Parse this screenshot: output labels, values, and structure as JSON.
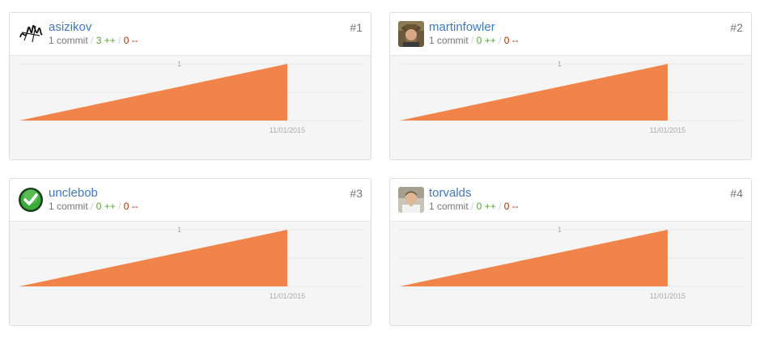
{
  "contributors": [
    {
      "rank": "#1",
      "username": "asizikov",
      "commits": "1 commit",
      "additions": "3 ++",
      "deletions": "0 --",
      "avatar_icon": "signature-avatar-icon",
      "chart_data": {
        "type": "area",
        "x": [
          "",
          "11/01/2015"
        ],
        "y": [
          0,
          1
        ],
        "ylim": [
          0,
          1
        ],
        "y_ticks": [
          "1"
        ],
        "x_ticks": [
          "11/01/2015"
        ],
        "color": "#f1844a"
      }
    },
    {
      "rank": "#2",
      "username": "martinfowler",
      "commits": "1 commit",
      "additions": "0 ++",
      "deletions": "0 --",
      "avatar_icon": "photo-avatar-icon",
      "chart_data": {
        "type": "area",
        "x": [
          "",
          "11/01/2015"
        ],
        "y": [
          0,
          1
        ],
        "ylim": [
          0,
          1
        ],
        "y_ticks": [
          "1"
        ],
        "x_ticks": [
          "11/01/2015"
        ],
        "color": "#f1844a"
      }
    },
    {
      "rank": "#3",
      "username": "unclebob",
      "commits": "1 commit",
      "additions": "0 ++",
      "deletions": "0 --",
      "avatar_icon": "green-check-avatar-icon",
      "chart_data": {
        "type": "area",
        "x": [
          "",
          "11/01/2015"
        ],
        "y": [
          0,
          1
        ],
        "ylim": [
          0,
          1
        ],
        "y_ticks": [
          "1"
        ],
        "x_ticks": [
          "11/01/2015"
        ],
        "color": "#f1844a"
      }
    },
    {
      "rank": "#4",
      "username": "torvalds",
      "commits": "1 commit",
      "additions": "0 ++",
      "deletions": "0 --",
      "avatar_icon": "photo-avatar-icon",
      "chart_data": {
        "type": "area",
        "x": [
          "",
          "11/01/2015"
        ],
        "y": [
          0,
          1
        ],
        "ylim": [
          0,
          1
        ],
        "y_ticks": [
          "1"
        ],
        "x_ticks": [
          "11/01/2015"
        ],
        "color": "#f1844a"
      }
    }
  ],
  "colors": {
    "link": "#4078c0",
    "additions": "#55a532",
    "deletions": "#bd2c00",
    "chart_fill": "#f1844a",
    "chart_bg": "#f5f5f5"
  }
}
